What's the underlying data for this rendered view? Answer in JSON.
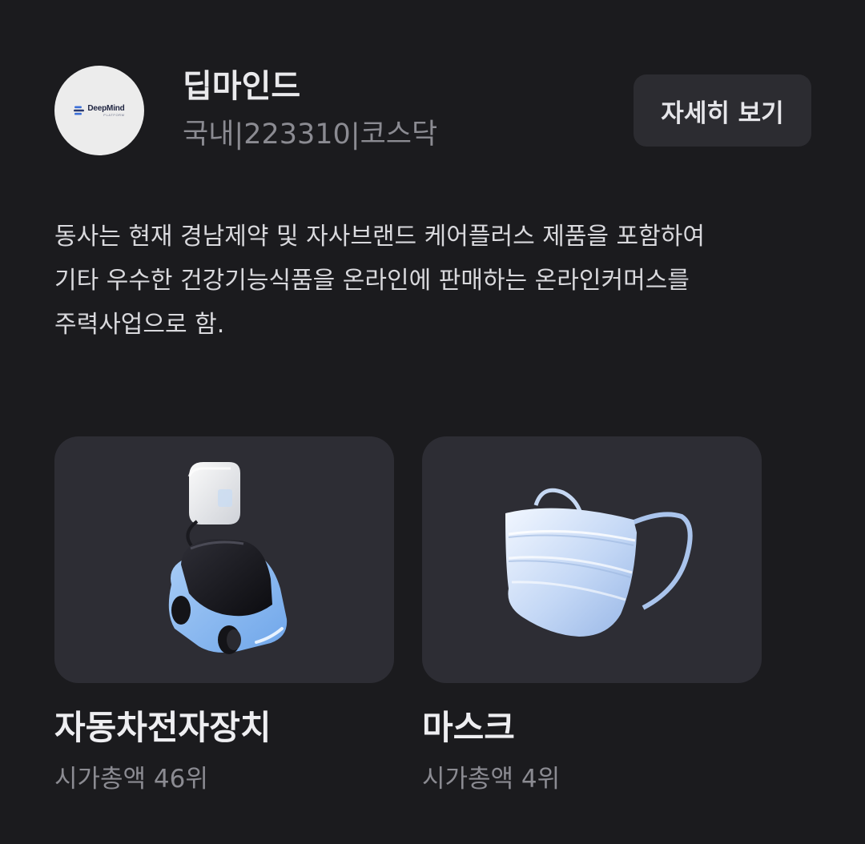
{
  "company": {
    "logo_text": "DeepMind",
    "logo_subtext": "PLATFORM",
    "name": "딥마인드",
    "meta": "국내|223310|코스닥",
    "detail_button_label": "자세히 보기"
  },
  "description": "동사는 현재 경남제약 및 자사브랜드 케어플러스 제품을 포함하여\n기타 우수한 건강기능식품을 온라인에 판매하는 온라인커머스를\n주력사업으로 함.",
  "themes": [
    {
      "title": "자동차전자장치",
      "rank": "시가총액 46위",
      "icon": "electric-car-icon"
    },
    {
      "title": "마스크",
      "rank": "시가총액 4위",
      "icon": "face-mask-icon"
    }
  ],
  "colors": {
    "background": "#1b1b1e",
    "card": "#2d2d34",
    "button": "#2c2c31",
    "muted_text": "#8b8b92"
  }
}
